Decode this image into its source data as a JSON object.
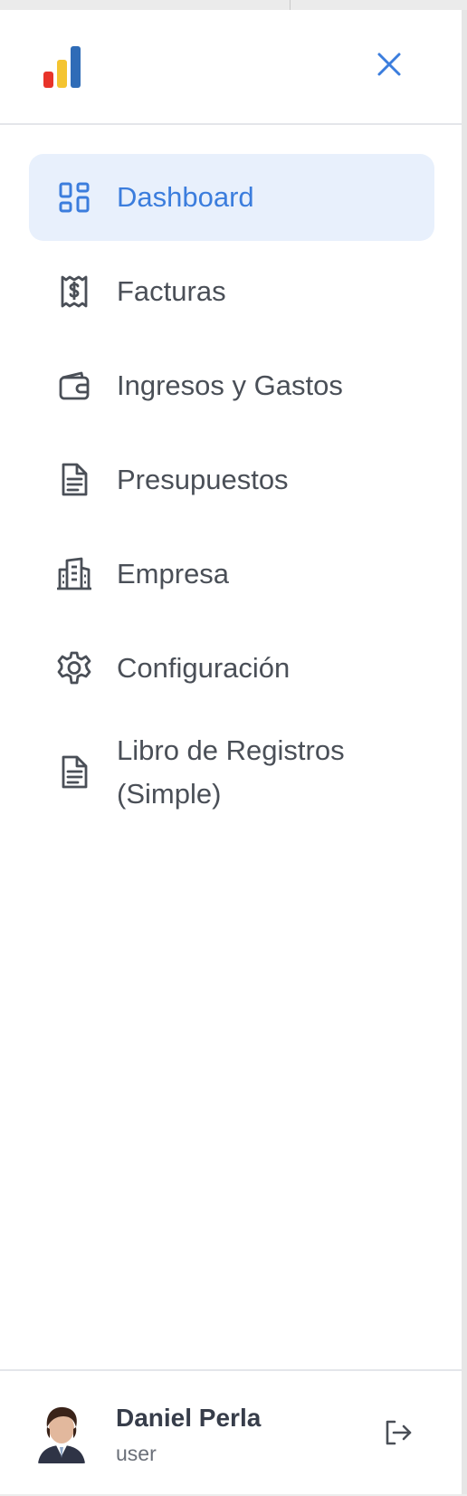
{
  "browser": {
    "top_bar": ""
  },
  "header": {
    "logo_icon": "bar-chart-logo",
    "logo_colors": [
      "#e8342a",
      "#f4c430",
      "#2f6cb7"
    ],
    "close_icon": "close-icon",
    "accent": "#3b7ddd"
  },
  "nav": {
    "items": [
      {
        "label": "Dashboard",
        "icon": "dashboard-grid-icon",
        "active": true
      },
      {
        "label": "Facturas",
        "icon": "receipt-dollar-icon",
        "active": false
      },
      {
        "label": "Ingresos y Gastos",
        "icon": "wallet-icon",
        "active": false
      },
      {
        "label": "Presupuestos",
        "icon": "document-icon",
        "active": false
      },
      {
        "label": "Empresa",
        "icon": "building-icon",
        "active": false
      },
      {
        "label": "Configuración",
        "icon": "gear-icon",
        "active": false
      },
      {
        "label": "Libro de Registros (Simple)",
        "icon": "document-icon",
        "active": false
      }
    ]
  },
  "user": {
    "name": "Daniel Perla",
    "role": "user",
    "avatar": "avatar",
    "logout_icon": "logout-icon"
  }
}
